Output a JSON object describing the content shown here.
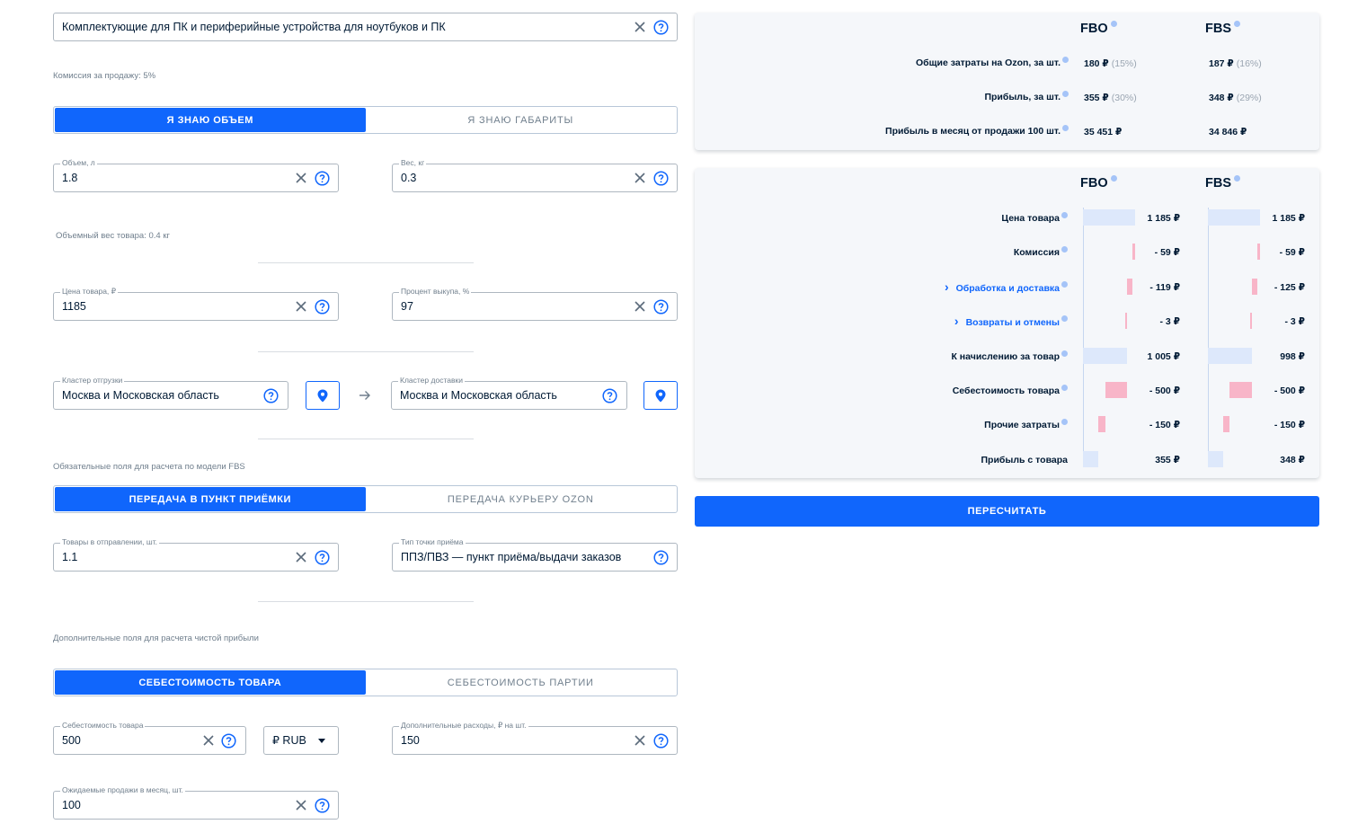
{
  "category": {
    "value": "Комплектующие для ПК и периферийные устройства для ноутбуков и ПК",
    "commission_text": "Комиссия за продажу: 5%"
  },
  "size_mode": {
    "options": [
      "Я знаю объем",
      "Я знаю габариты"
    ],
    "selected": "Я знаю объем"
  },
  "volume": {
    "label": "Объем, л",
    "value": "1.8"
  },
  "weight": {
    "label": "Вес, кг",
    "value": "0.3"
  },
  "volumetric_weight_text": "Объемный вес товара: 0.4 кг",
  "price": {
    "label": "Цена товара, ₽",
    "value": "1185"
  },
  "buyout": {
    "label": "Процент выкупа, %",
    "value": "97"
  },
  "shipping_cluster": {
    "label": "Кластер отгрузки",
    "value": "Москва и Московская область"
  },
  "delivery_cluster": {
    "label": "Кластер доставки",
    "value": "Москва и Московская область"
  },
  "fbs_section_text": "Обязательные поля для расчета по модели FBS",
  "fbs_mode": {
    "options": [
      "Передача в пункт приёмки",
      "Передача курьеру Ozon"
    ],
    "selected": "Передача в пункт приёмки"
  },
  "items_per_shipment": {
    "label": "Товары в отправлении, шт.",
    "value": "1.1"
  },
  "point_type": {
    "label": "Тип точки приёма",
    "value": "ППЗ/ПВЗ — пункт приёма/выдачи заказов"
  },
  "extra_section_text": "Дополнительные поля для расчета чистой прибыли",
  "cost_mode": {
    "options": [
      "Себестоимость товара",
      "Себестоимость партии"
    ],
    "selected": "Себестоимость товара"
  },
  "cost": {
    "label": "Себестоимость товара",
    "value": "500"
  },
  "currency": {
    "value": "₽ RUB"
  },
  "extra_costs": {
    "label": "Дополнительные расходы, ₽ на шт.",
    "value": "150"
  },
  "monthly_sales": {
    "label": "Ожидаемые продажи в месяц, шт.",
    "value": "100"
  },
  "summary": {
    "col_fbo": "FBO",
    "col_fbs": "FBS",
    "rows": [
      {
        "label": "Общие затраты на Ozon, за шт.",
        "fbo": "180 ₽",
        "fbo_pct": "(15%)",
        "fbs": "187 ₽",
        "fbs_pct": "(16%)"
      },
      {
        "label": "Прибыль, за шт.",
        "fbo": "355 ₽",
        "fbo_pct": "(30%)",
        "fbs": "348 ₽",
        "fbs_pct": "(29%)"
      },
      {
        "label": "Прибыль в месяц от продажи 100 шт.",
        "fbo": "35 451 ₽",
        "fbo_pct": "",
        "fbs": "34 846 ₽",
        "fbs_pct": ""
      }
    ]
  },
  "breakdown": {
    "col_fbo": "FBO",
    "col_fbs": "FBS",
    "rows": [
      {
        "label": "Цена товара",
        "fbo": "1 185 ₽",
        "fbs": "1 185 ₽",
        "fbo_num": 1185,
        "fbs_num": 1185,
        "link": false,
        "info": true
      },
      {
        "label": "Комиссия",
        "fbo": "- 59 ₽",
        "fbs": "- 59 ₽",
        "fbo_num": -59,
        "fbs_num": -59,
        "link": false,
        "info": true
      },
      {
        "label": "Обработка и доставка",
        "fbo": "- 119 ₽",
        "fbs": "- 125 ₽",
        "fbo_num": -119,
        "fbs_num": -125,
        "link": true,
        "info": true
      },
      {
        "label": "Возвраты и отмены",
        "fbo": "- 3 ₽",
        "fbs": "- 3 ₽",
        "fbo_num": -3,
        "fbs_num": -3,
        "link": true,
        "info": true
      },
      {
        "label": "К начислению за товар",
        "fbo": "1 005 ₽",
        "fbs": "998 ₽",
        "fbo_num": 1005,
        "fbs_num": 998,
        "link": false,
        "info": true
      },
      {
        "label": "Себестоимость товара",
        "fbo": "- 500 ₽",
        "fbs": "- 500 ₽",
        "fbo_num": -500,
        "fbs_num": -500,
        "link": false,
        "info": true
      },
      {
        "label": "Прочие затраты",
        "fbo": "- 150 ₽",
        "fbs": "- 150 ₽",
        "fbo_num": -150,
        "fbs_num": -150,
        "link": false,
        "info": true
      },
      {
        "label": "Прибыль с товара",
        "fbo": "355 ₽",
        "fbs": "348 ₽",
        "fbo_num": 355,
        "fbs_num": 348,
        "link": false,
        "info": false
      }
    ]
  },
  "recalc_button": "Пересчитать",
  "colors": {
    "accent": "#1066fc",
    "negative_bar": "#f8b5c8",
    "positive_bar": "#dde8fb"
  }
}
